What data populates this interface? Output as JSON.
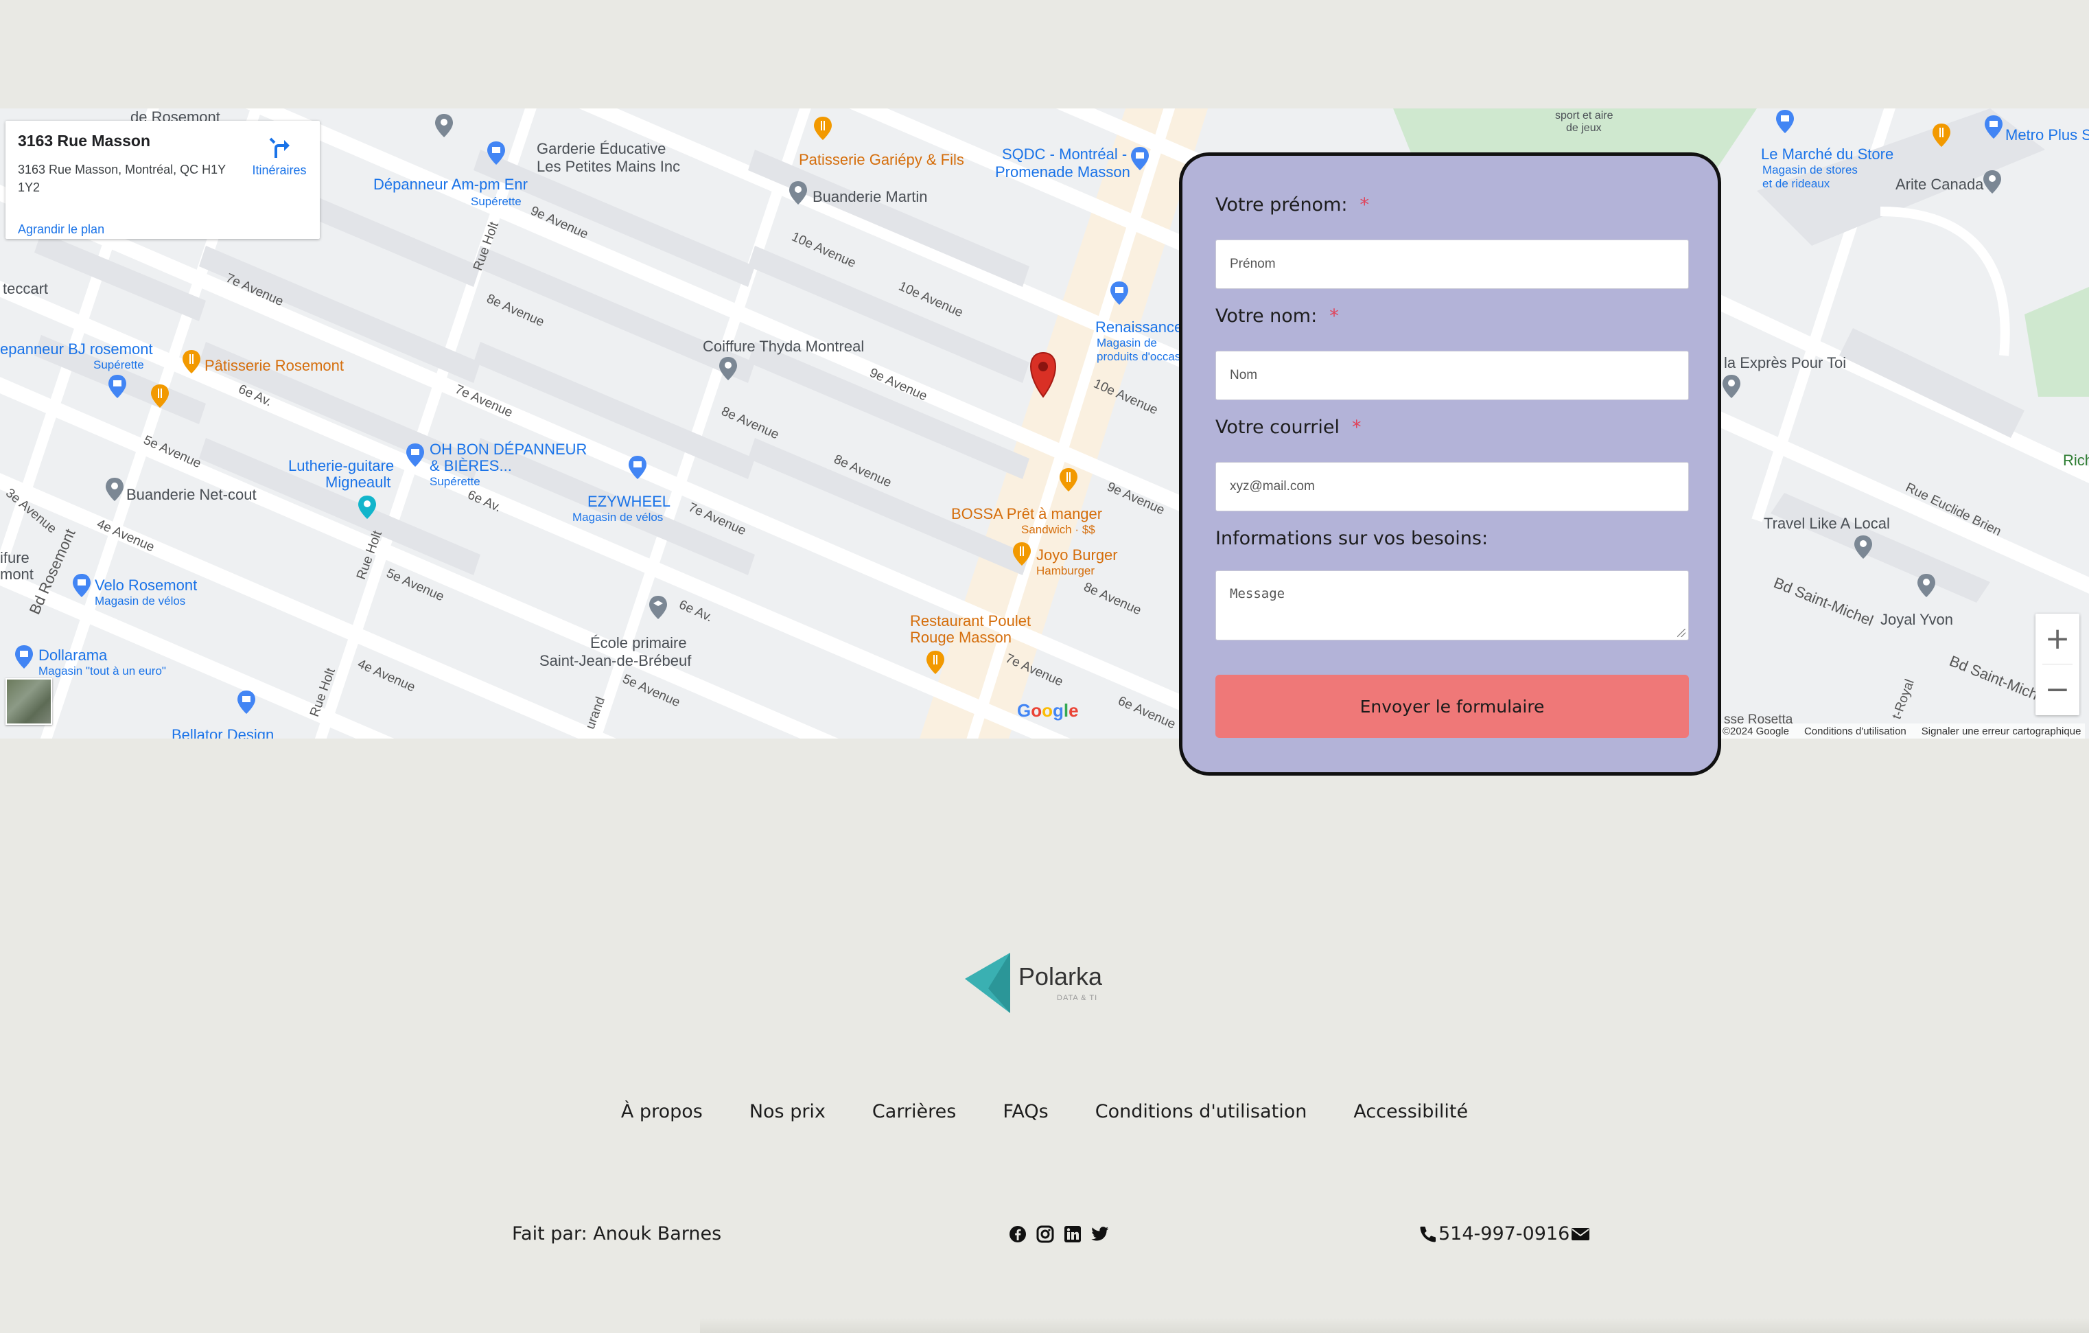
{
  "map": {
    "place_name": "3163 Rue Masson",
    "place_address": "3163 Rue Masson, Montréal, QC H1Y 1Y2",
    "directions_label": "Itinéraires",
    "enlarge_label": "Agrandir le plan",
    "zoom_in": "+",
    "zoom_out": "−",
    "google_logo": "Google",
    "attribution": {
      "copyright": "©2024 Google",
      "terms": "Conditions d'utilisation",
      "report": "Signaler une erreur cartographique"
    },
    "labels": {
      "de_rosemont": "de Rosemont",
      "depanneur_ampm": "Dépanneur Am-pm Enr",
      "superette1": "Supérette",
      "garderie": "Garderie Éducative",
      "garderie2": "Les Petites Mains Inc",
      "patisserie_gariepy": "Patisserie Gariépy & Fils",
      "buanderie_martin": "Buanderie Martin",
      "sqdc": "SQDC - Montréal -",
      "sqdc2": "Promenade Masson",
      "renaissance": "Renaissance",
      "renaissance_sub1": "Magasin de",
      "renaissance_sub2": "produits d'occas",
      "teccart": "teccart",
      "depanneur_bj": "epanneur BJ rosemont",
      "superette2": "Supérette",
      "patisserie_rosemont": "Pâtisserie Rosemont",
      "coiffure": "Coiffure Thyda Montreal",
      "oh_bon": "OH BON DÉPANNEUR",
      "oh_bon2": "& BIÈRES...",
      "superette3": "Supérette",
      "lutherie": "Lutherie-guitare",
      "lutherie2": "Migneault",
      "ezywheel": "EZYWHEEL",
      "ezywheel_sub": "Magasin de vélos",
      "buanderie_netcout": "Buanderie Net-cout",
      "bossa": "BOSSA Prêt à manger",
      "bossa_sub": "Sandwich · $$",
      "joyo": "Joyo Burger",
      "joyo_sub": "Hamburger",
      "velo_rosemont": "Velo Rosemont",
      "velo_sub": "Magasin de vélos",
      "restaurant_poulet": "Restaurant Poulet",
      "restaurant_poulet2": "Rouge Masson",
      "ecole": "École primaire",
      "ecole2": "Saint-Jean-de-Brébeuf",
      "dollarama": "Dollarama",
      "dollarama_sub": "Magasin \"tout à un euro\"",
      "bellator": "Bellator Design",
      "sport": "sport et aire",
      "sport2": "de jeux",
      "marche_store": "Le Marché du Store",
      "marche_sub1": "Magasin de stores",
      "marche_sub2": "et de rideaux",
      "metro_plus": "Metro Plus S",
      "arite": "Arite Canada",
      "la_expres": "la Exprès Pour Toi",
      "travel": "Travel Like A Local",
      "joyal": "Joyal Yvon",
      "rue_euclide": "Rue Euclide Brien",
      "bd_st_michel": "Bd Saint-Michel",
      "bd_st_michel2": "Bd Saint-Michel",
      "bd_rosemont": "Bd Rosemont",
      "rich": "Rich",
      "furre": "ifure",
      "mont": "mont",
      "streets": {
        "s7e_a": "7e Avenue",
        "s8e_a": "8e Avenue",
        "s9e_a": "9e Avenue",
        "s10e_a": "10e Avenue",
        "s6e_a": "6e Av.",
        "s5e_a": "5e Avenue",
        "s4e_a": "4e Avenue",
        "s3e_a": "3e Avenue",
        "s9e_b": "9e Avenue",
        "s10e_b": "10e Avenue",
        "s8e_b": "8e Avenue",
        "s7e_b": "7e Avenue",
        "s6e_b": "6e Av.",
        "s5e_b": "5e Avenue",
        "s9e_c": "9e Avenue",
        "s10e_c": "10e Avenue",
        "s8e_c": "8e Avenue",
        "s7e_c": "7e Avenue",
        "s6e_c": "6e Av.",
        "s5e_c": "5e Avenue",
        "s4e_b": "4e Avenue",
        "s8e_d": "8e Avenue",
        "s7e_d": "7e Avenue",
        "s6e_d": "6e Avenue",
        "rue_holt1": "Rue Holt",
        "rue_holt2": "Rue Holt",
        "rue_holt3": "Rue Holt",
        "rue_durand": "urand",
        "st_royal": "t-Royal",
        "rosetta": "sse Rosetta"
      }
    }
  },
  "form": {
    "first_name_label": "Votre prénom:",
    "first_name_placeholder": "Prénom",
    "last_name_label": "Votre nom:",
    "last_name_placeholder": "Nom",
    "email_label": "Votre courriel",
    "email_placeholder": "xyz@mail.com",
    "needs_label": "Informations sur vos besoins:",
    "message_placeholder": "Message",
    "required_mark": "*",
    "submit_label": "Envoyer le formulaire"
  },
  "footer": {
    "logo_word": "Polarka",
    "logo_tag": "DATA & TI",
    "nav": [
      "À propos",
      "Nos prix",
      "Carrières",
      "FAQs",
      "Conditions d'utilisation",
      "Accessibilité"
    ],
    "made_by": "Fait par: Anouk Barnes",
    "socials": [
      "facebook-icon",
      "instagram-icon",
      "linkedin-icon",
      "twitter-icon"
    ],
    "phone": "514-997-0916"
  },
  "colors": {
    "page_bg": "#e9e9e4",
    "form_bg": "#b3b3d8",
    "submit_bg": "#ef7878",
    "required": "#e0435a",
    "logo_teal": "#3ab0b2",
    "map_blue": "#1a73e8",
    "map_orange": "#d56e0c",
    "pin_red": "#d93025"
  }
}
